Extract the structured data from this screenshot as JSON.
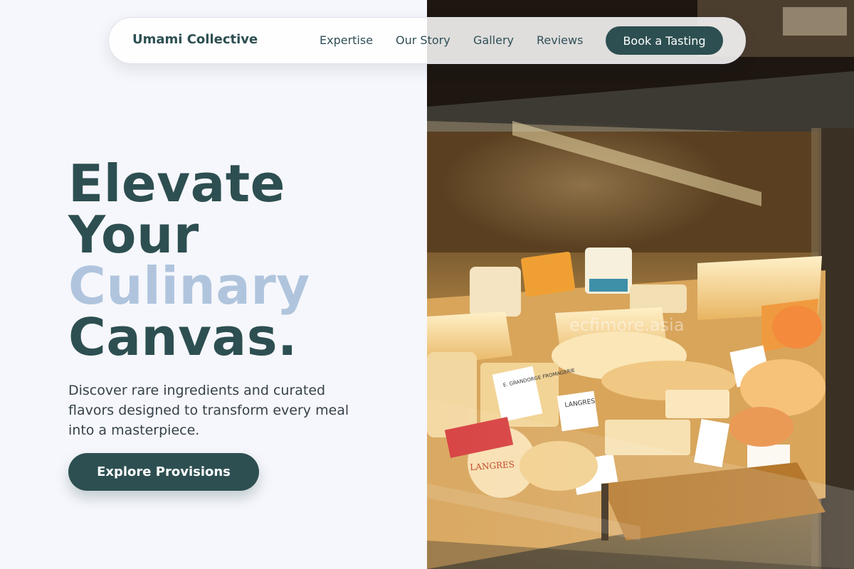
{
  "brand": {
    "name": "Umami Collective"
  },
  "nav": {
    "links": [
      "Expertise",
      "Our Story",
      "Gallery",
      "Reviews"
    ],
    "cta_label": "Book a Tasting"
  },
  "hero": {
    "headline": {
      "line1": "Elevate",
      "line2": "Your",
      "line3": "Culinary",
      "line4": "Canvas."
    },
    "subtitle": "Discover rare ingredients and curated flavors designed to transform every meal into a masterpiece.",
    "cta_label": "Explore Provisions"
  },
  "photo": {
    "watermark": "ecfimore.asia",
    "labels": [
      "E. GRANDORGE FROMAGERIE",
      "LANGRES",
      "LANGRES"
    ]
  },
  "colors": {
    "primary": "#2d4f51",
    "accent": "#b0c5dd",
    "background": "#f6f7fc"
  }
}
